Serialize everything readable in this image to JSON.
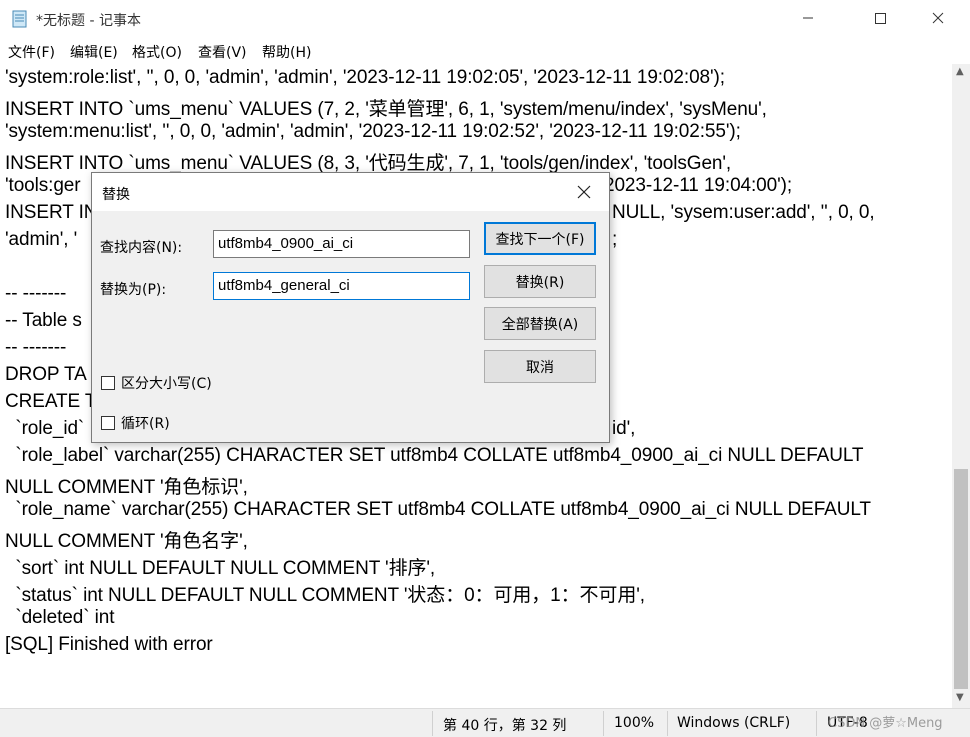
{
  "window": {
    "title": "*无标题 - 记事本",
    "icon": "notepad-icon"
  },
  "menu": {
    "items": [
      "文件(F)",
      "编辑(E)",
      "格式(O)",
      "查看(V)",
      "帮助(H)"
    ]
  },
  "editor": {
    "lines": [
      "'system:role:list', '', 0, 0, 'admin', 'admin', '2023-12-11 19:02:05', '2023-12-11 19:02:08');",
      "INSERT INTO `ums_menu` VALUES (7, 2, '菜单管理', 6, 1, 'system/menu/index', 'sysMenu',",
      "'system:menu:list', '', 0, 0, 'admin', 'admin', '2023-12-11 19:02:52', '2023-12-11 19:02:55');",
      "INSERT INTO `ums_menu` VALUES (8, 3, '代码生成', 7, 1, 'tools/gen/index', 'toolsGen',",
      "'tools:ger",
      "INSERT IN",
      "'admin', '",
      "",
      "-- -------",
      "-- Table s",
      "-- -------",
      "DROP TA",
      "CREATE T",
      "  `role_id`",
      "  `role_label` varchar(255) CHARACTER SET utf8mb4 COLLATE utf8mb4_0900_ai_ci NULL DEFAULT",
      "NULL COMMENT '角色标识',",
      "  `role_name` varchar(255) CHARACTER SET utf8mb4 COLLATE utf8mb4_0900_ai_ci NULL DEFAULT",
      "NULL COMMENT '角色名字',",
      "  `sort` int NULL DEFAULT NULL COMMENT '排序',",
      "  `status` int NULL DEFAULT NULL COMMENT '状态：0：可用，1：不可用',",
      "  `deleted` int",
      "[SQL] Finished with error"
    ],
    "overflow_fragments": [
      "2023-12-11 19:04:00');",
      "NULL, 'sysem:user:add', '', 0, 0,",
      ";",
      "id',"
    ]
  },
  "dialog": {
    "title": "替换",
    "find_label": "查找内容(N):",
    "find_value": "utf8mb4_0900_ai_ci",
    "replace_label": "替换为(P):",
    "replace_value": "utf8mb4_general_ci",
    "buttons": {
      "find_next": "查找下一个(F)",
      "replace": "替换(R)",
      "replace_all": "全部替换(A)",
      "cancel": "取消"
    },
    "options": {
      "match_case": "区分大小写(C)",
      "wrap": "循环(R)"
    }
  },
  "statusbar": {
    "position": "第 40 行，第 32 列",
    "zoom": "100%",
    "line_ending": "Windows (CRLF)",
    "encoding": "UTF-8"
  },
  "watermark": "CSDN @萝☆Meng"
}
